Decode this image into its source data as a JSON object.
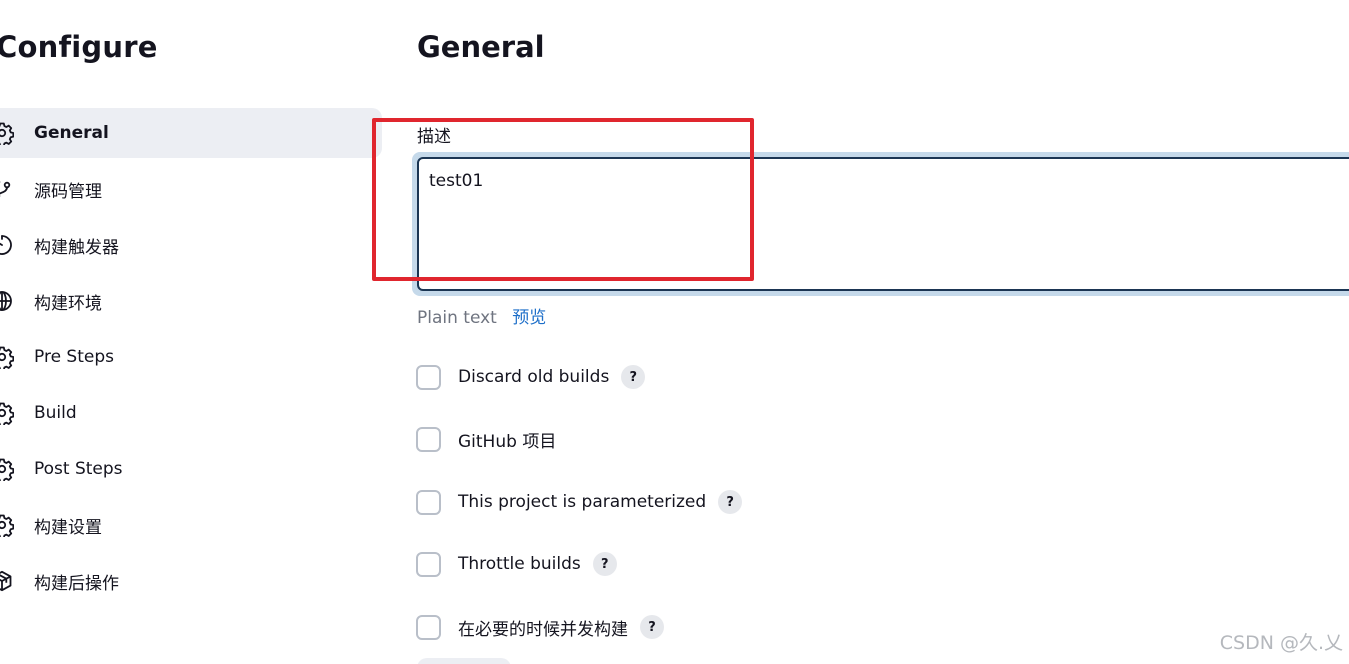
{
  "sidebar": {
    "title": "Configure",
    "items": [
      {
        "label": "General",
        "icon": "gear-icon",
        "active": true
      },
      {
        "label": "源码管理",
        "icon": "source-branch-icon",
        "active": false
      },
      {
        "label": "构建触发器",
        "icon": "timer-icon",
        "active": false
      },
      {
        "label": "构建环境",
        "icon": "globe-icon",
        "active": false
      },
      {
        "label": "Pre Steps",
        "icon": "gear-icon",
        "active": false
      },
      {
        "label": "Build",
        "icon": "gear-icon",
        "active": false
      },
      {
        "label": "Post Steps",
        "icon": "gear-icon",
        "active": false
      },
      {
        "label": "构建设置",
        "icon": "gear-icon",
        "active": false
      },
      {
        "label": "构建后操作",
        "icon": "package-icon",
        "active": false
      }
    ]
  },
  "main": {
    "title": "General",
    "description": {
      "label": "描述",
      "value": "test01",
      "format_text": "Plain text",
      "preview_label": "预览"
    },
    "options": [
      {
        "label": "Discard old builds",
        "checked": false,
        "help": "?"
      },
      {
        "label": "GitHub 项目",
        "checked": false,
        "help": ""
      },
      {
        "label": "This project is parameterized",
        "checked": false,
        "help": "?"
      },
      {
        "label": "Throttle builds",
        "checked": false,
        "help": "?"
      },
      {
        "label": "在必要的时候并发构建",
        "checked": false,
        "help": "?"
      }
    ]
  },
  "watermark": "CSDN @久.乂",
  "colors": {
    "accent_link": "#1e6fc9",
    "active_nav_bg": "#eceef3",
    "annotation_red": "#e0262e",
    "focus_border": "#1b3553",
    "focus_ring": "#c5d9ea"
  }
}
